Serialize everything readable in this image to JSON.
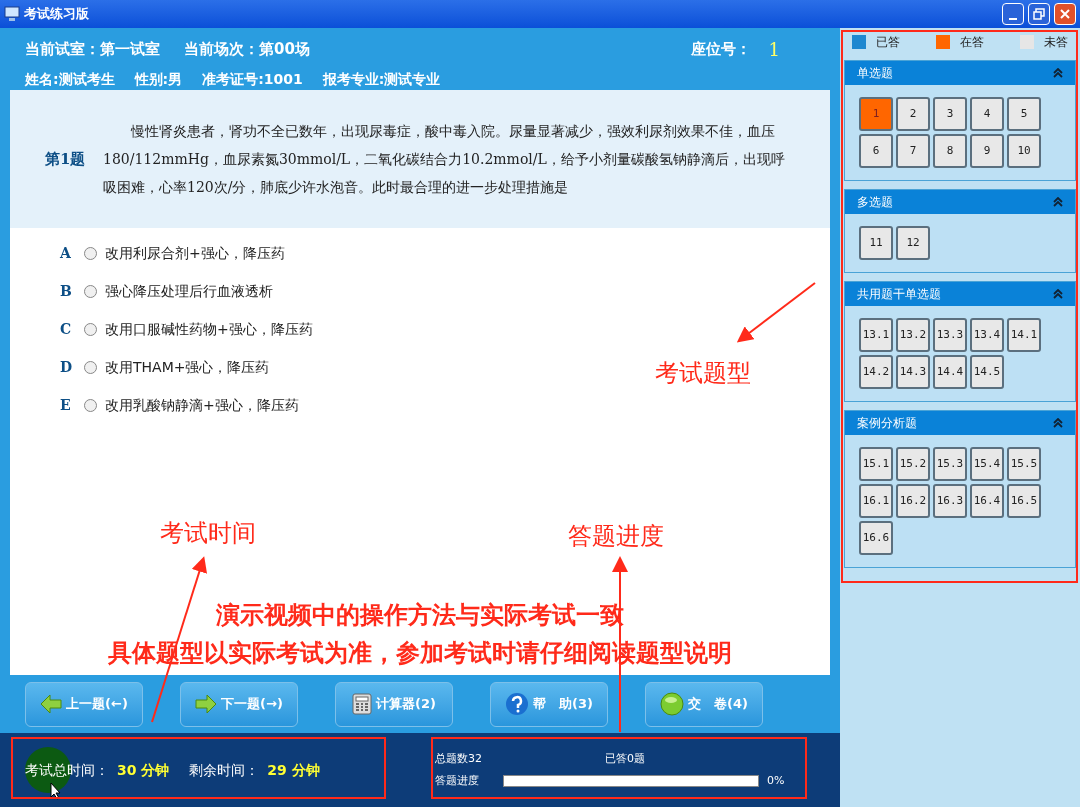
{
  "window": {
    "title": "考试练习版"
  },
  "info_row1": [
    "当前试室：第一试室",
    "当前场次：第00场"
  ],
  "seat": {
    "label": "座位号：",
    "value": "1"
  },
  "info_row2": [
    "姓名:测试考生",
    "性别:男",
    "准考证号:1001",
    "报考专业:测试专业"
  ],
  "question": {
    "number": "第1题",
    "text": "慢性肾炎患者，肾功不全已数年，出现尿毒症，酸中毒入院。尿量显著减少，强效利尿剂效果不佳，血压180/112mmHg，血尿素氮30mmol/L，二氧化碳结合力10.2mmol/L，给予小剂量碳酸氢钠静滴后，出现呼吸困难，心率120次/分，肺底少许水泡音。此时最合理的进一步处理措施是",
    "options": [
      {
        "letter": "A",
        "text": "改用利尿合剂+强心，降压药",
        "selected": false
      },
      {
        "letter": "B",
        "text": "强心降压处理后行血液透析",
        "selected": false
      },
      {
        "letter": "C",
        "text": "改用口服碱性药物+强心，降压药",
        "selected": false
      },
      {
        "letter": "D",
        "text": "改用THAM+强心，降压药",
        "selected": false
      },
      {
        "letter": "E",
        "text": "改用乳酸钠静滴+强心，降压药",
        "selected": false
      }
    ]
  },
  "notes": [
    "演示视频中的操作方法与实际考试一致",
    "具体题型以实际考试为准，参加考试时请仔细阅读题型说明"
  ],
  "buttons": [
    {
      "kind": "prev",
      "label": "上一题(←)"
    },
    {
      "kind": "next",
      "label": "下一题(→)"
    },
    {
      "kind": "calculator",
      "label": "计算器(2)"
    },
    {
      "kind": "help",
      "label": "帮　助(3)"
    },
    {
      "kind": "submit",
      "label": "交　卷(4)"
    }
  ],
  "status": {
    "total_time_label": "考试总时间：",
    "total_time": "30 分钟",
    "remaining_label": "剩余时间：",
    "remaining": "29 分钟",
    "total_count": "总题数32",
    "answered": "已答0题",
    "progress_label": "答题进度",
    "progress": {
      "level": 0
    },
    "progress_reading": "0%"
  },
  "legend": [
    {
      "label": "已答",
      "color": "#1e88d0"
    },
    {
      "label": "在答",
      "color": "#ff6600"
    },
    {
      "label": "未答",
      "color": "#e6e6e6"
    }
  ],
  "sections": [
    {
      "title": "单选题",
      "items": [
        {
          "label": "1",
          "selected": true
        },
        {
          "label": "2",
          "selected": false
        },
        {
          "label": "3",
          "selected": false
        },
        {
          "label": "4",
          "selected": false
        },
        {
          "label": "5",
          "selected": false
        },
        {
          "label": "6",
          "selected": false
        },
        {
          "label": "7",
          "selected": false
        },
        {
          "label": "8",
          "selected": false
        },
        {
          "label": "9",
          "selected": false
        },
        {
          "label": "10",
          "selected": false
        }
      ]
    },
    {
      "title": "多选题",
      "items": [
        {
          "label": "11",
          "selected": false
        },
        {
          "label": "12",
          "selected": false
        }
      ]
    },
    {
      "title": "共用题干单选题",
      "items": [
        {
          "label": "13.1",
          "selected": false
        },
        {
          "label": "13.2",
          "selected": false
        },
        {
          "label": "13.3",
          "selected": false
        },
        {
          "label": "13.4",
          "selected": false
        },
        {
          "label": "14.1",
          "selected": false
        },
        {
          "label": "14.2",
          "selected": false
        },
        {
          "label": "14.3",
          "selected": false
        },
        {
          "label": "14.4",
          "selected": false
        },
        {
          "label": "14.5",
          "selected": false
        }
      ]
    },
    {
      "title": "案例分析题",
      "items": [
        {
          "label": "15.1",
          "selected": false
        },
        {
          "label": "15.2",
          "selected": false
        },
        {
          "label": "15.3",
          "selected": false
        },
        {
          "label": "15.4",
          "selected": false
        },
        {
          "label": "15.5",
          "selected": false
        },
        {
          "label": "16.1",
          "selected": false
        },
        {
          "label": "16.2",
          "selected": false
        },
        {
          "label": "16.3",
          "selected": false
        },
        {
          "label": "16.4",
          "selected": false
        },
        {
          "label": "16.5",
          "selected": false
        },
        {
          "label": "16.6",
          "selected": false
        }
      ]
    }
  ],
  "annotations": [
    {
      "kind": "types",
      "text": "考试题型"
    },
    {
      "kind": "time",
      "text": "考试时间"
    },
    {
      "kind": "progress",
      "text": "答题进度"
    }
  ]
}
